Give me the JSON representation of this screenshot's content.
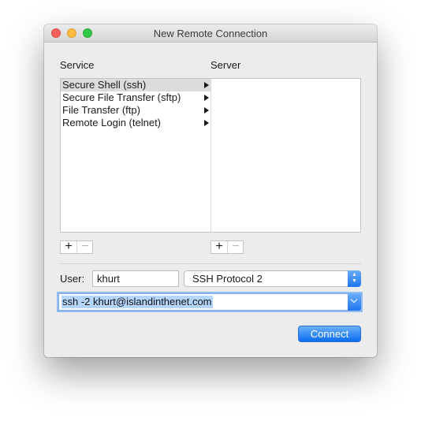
{
  "window": {
    "title": "New Remote Connection"
  },
  "service_column": {
    "label": "Service",
    "items": [
      {
        "label": "Secure Shell (ssh)",
        "selected": true
      },
      {
        "label": "Secure File Transfer (sftp)",
        "selected": false
      },
      {
        "label": "File Transfer (ftp)",
        "selected": false
      },
      {
        "label": "Remote Login (telnet)",
        "selected": false
      }
    ],
    "add_label": "+",
    "remove_label": "−"
  },
  "server_column": {
    "label": "Server",
    "items": [],
    "add_label": "+",
    "remove_label": "−"
  },
  "user": {
    "label": "User:",
    "value": "khurt"
  },
  "protocol": {
    "selected": "SSH Protocol 2"
  },
  "command": {
    "value": "ssh -2 khurt@islandinthenet.com"
  },
  "actions": {
    "connect_label": "Connect"
  },
  "colors": {
    "accent": "#1f74f2",
    "selection_highlight": "#b4d5fe",
    "close": "#fc605c",
    "minimize": "#fdbc40",
    "zoom": "#34c84a"
  }
}
